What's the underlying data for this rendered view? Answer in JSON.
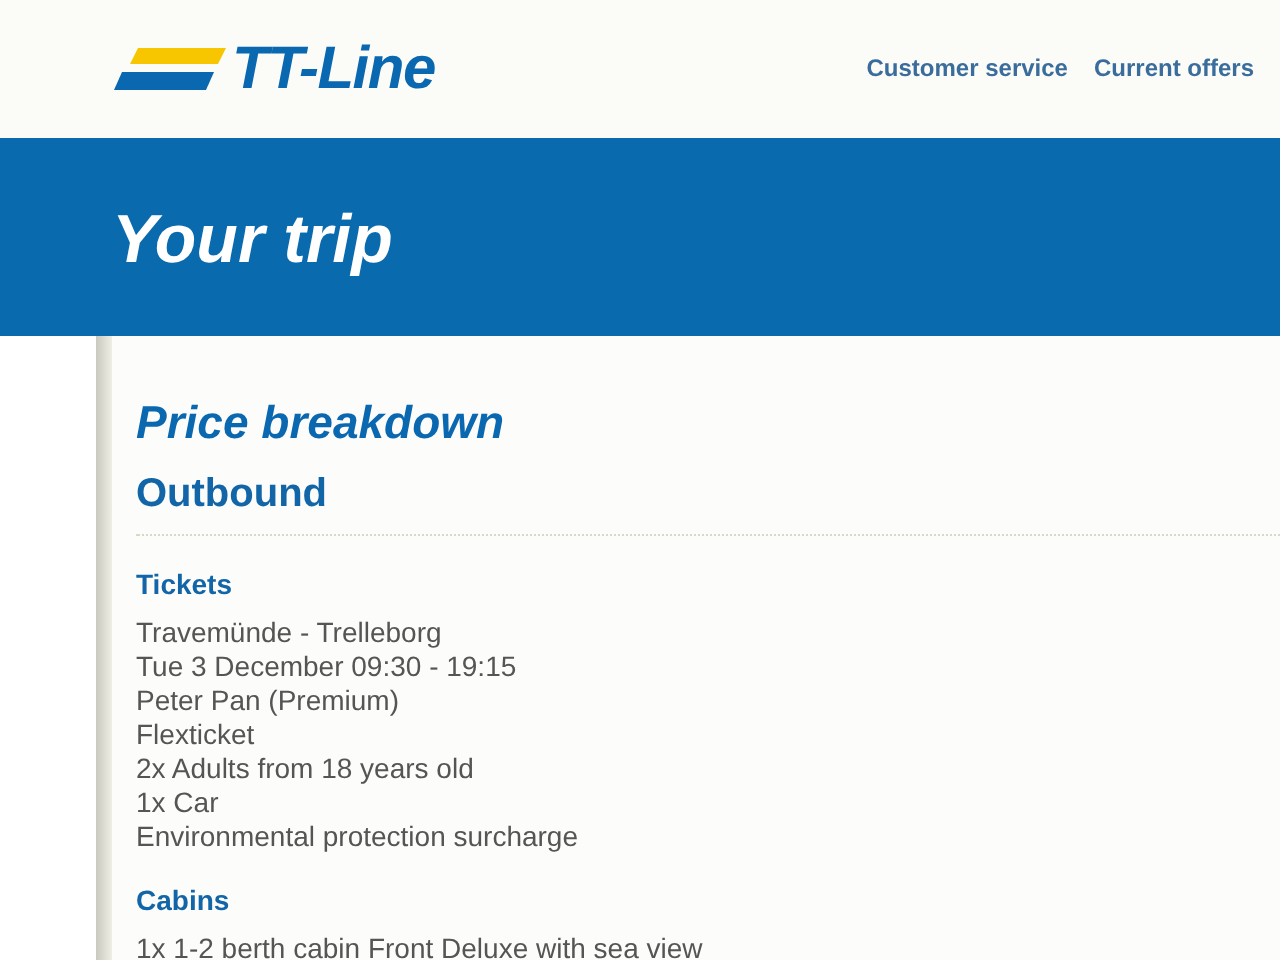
{
  "header": {
    "logo_text": "TT-Line",
    "nav_links": [
      "Customer service",
      "Current offers"
    ]
  },
  "banner": {
    "title": "Your trip"
  },
  "content": {
    "title": "Price breakdown",
    "direction": "Outbound",
    "sections": [
      {
        "heading": "Tickets",
        "lines": [
          "Travemünde - Trelleborg",
          "Tue 3 December 09:30 - 19:15",
          "Peter Pan (Premium)",
          "Flexticket",
          "2x Adults from 18 years old",
          "1x Car",
          "Environmental protection surcharge"
        ]
      },
      {
        "heading": "Cabins",
        "lines": [
          "1x 1-2 berth cabin Front Deluxe with sea view"
        ]
      }
    ]
  }
}
